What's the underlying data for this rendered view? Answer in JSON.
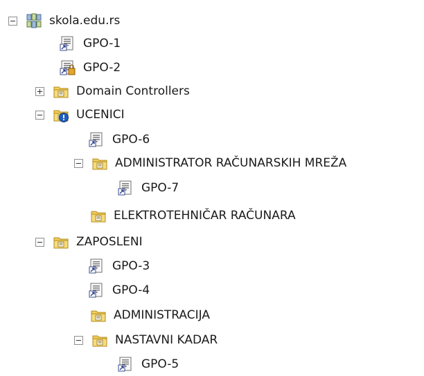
{
  "tree": {
    "root": {
      "label": "skola.edu.rs",
      "icon": "domain-icon",
      "expanded": true
    },
    "gpo1": {
      "label": "GPO-1",
      "icon": "gpo-link-icon"
    },
    "gpo2": {
      "label": "GPO-2",
      "icon": "gpo-locked-icon"
    },
    "domain_controllers": {
      "label": "Domain Controllers",
      "icon": "ou-folder-icon",
      "expanded": false
    },
    "ucenici": {
      "label": "UCENICI",
      "icon": "ou-warning-icon",
      "expanded": true
    },
    "gpo6": {
      "label": "GPO-6",
      "icon": "gpo-link-icon"
    },
    "admin_racunarskih": {
      "label": "ADMINISTRATOR RAČUNARSKIH MREŽA",
      "icon": "ou-folder-icon",
      "expanded": true
    },
    "gpo7": {
      "label": "GPO-7",
      "icon": "gpo-link-icon"
    },
    "elektrotehnicar": {
      "label": "ELEKTROTEHNIČAR RAČUNARA",
      "icon": "ou-folder-icon"
    },
    "zaposleni": {
      "label": "ZAPOSLENI",
      "icon": "ou-folder-icon",
      "expanded": true
    },
    "gpo3": {
      "label": "GPO-3",
      "icon": "gpo-link-icon"
    },
    "gpo4": {
      "label": "GPO-4",
      "icon": "gpo-link-icon"
    },
    "administracija": {
      "label": "ADMINISTRACIJA",
      "icon": "ou-folder-icon"
    },
    "nastavni_kadar": {
      "label": "NASTAVNI KADAR",
      "icon": "ou-folder-icon",
      "expanded": true
    },
    "gpo5": {
      "label": "GPO-5",
      "icon": "gpo-link-icon"
    }
  }
}
